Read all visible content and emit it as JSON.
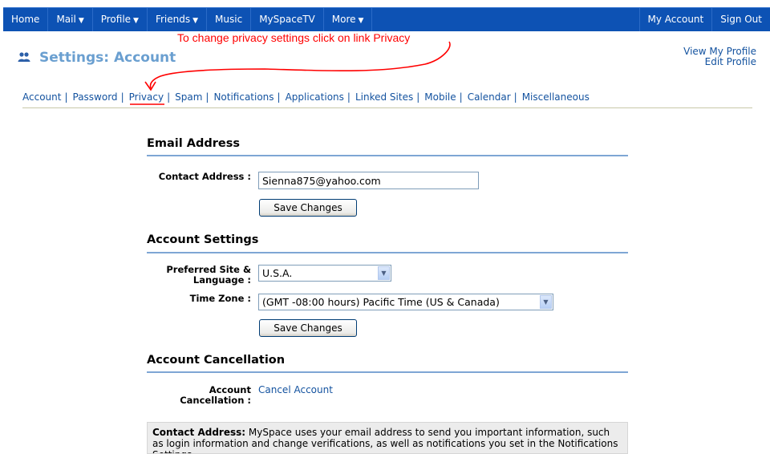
{
  "nav": {
    "left": [
      {
        "label": "Home",
        "caret": ""
      },
      {
        "label": "Mail",
        "caret": "▼"
      },
      {
        "label": "Profile",
        "caret": "▼"
      },
      {
        "label": "Friends",
        "caret": "▼"
      },
      {
        "label": "Music",
        "caret": ""
      },
      {
        "label": "MySpaceTV",
        "caret": ""
      },
      {
        "label": "More",
        "caret": "▼"
      }
    ],
    "right": [
      {
        "label": "My Account"
      },
      {
        "label": "Sign Out"
      }
    ]
  },
  "annotation": {
    "text": "To change privacy settings click on link Privacy",
    "color": "#ff0000"
  },
  "header": {
    "title": "Settings: Account",
    "view_profile": "View My Profile",
    "edit_profile": "Edit Profile"
  },
  "subnav": [
    "Account",
    "Password",
    "Privacy",
    "Spam",
    "Notifications",
    "Applications",
    "Linked Sites",
    "Mobile",
    "Calendar",
    "Miscellaneous"
  ],
  "email_section": {
    "title": "Email Address",
    "contact_label": "Contact Address :",
    "contact_value": "Sienna875@yahoo.com",
    "save_label": "Save Changes"
  },
  "account_section": {
    "title": "Account Settings",
    "site_label_1": "Preferred Site &",
    "site_label_2": "Language :",
    "site_value": "U.S.A.",
    "tz_label": "Time Zone :",
    "tz_value": "(GMT -08:00 hours) Pacific Time (US & Canada)",
    "save_label": "Save Changes"
  },
  "cancel_section": {
    "title": "Account Cancellation",
    "label_1": "Account",
    "label_2": "Cancellation :",
    "link": "Cancel Account"
  },
  "info": {
    "bold": "Contact Address:",
    "text": " MySpace uses your email address to send you important information, such as login information and change verifications, as well as notifications you set in the Notifications Settings."
  },
  "colors": {
    "nav_bg": "#0d52b4",
    "title": "#6a9fd0",
    "link": "#13529f",
    "section_rule": "#7ea6d4"
  }
}
